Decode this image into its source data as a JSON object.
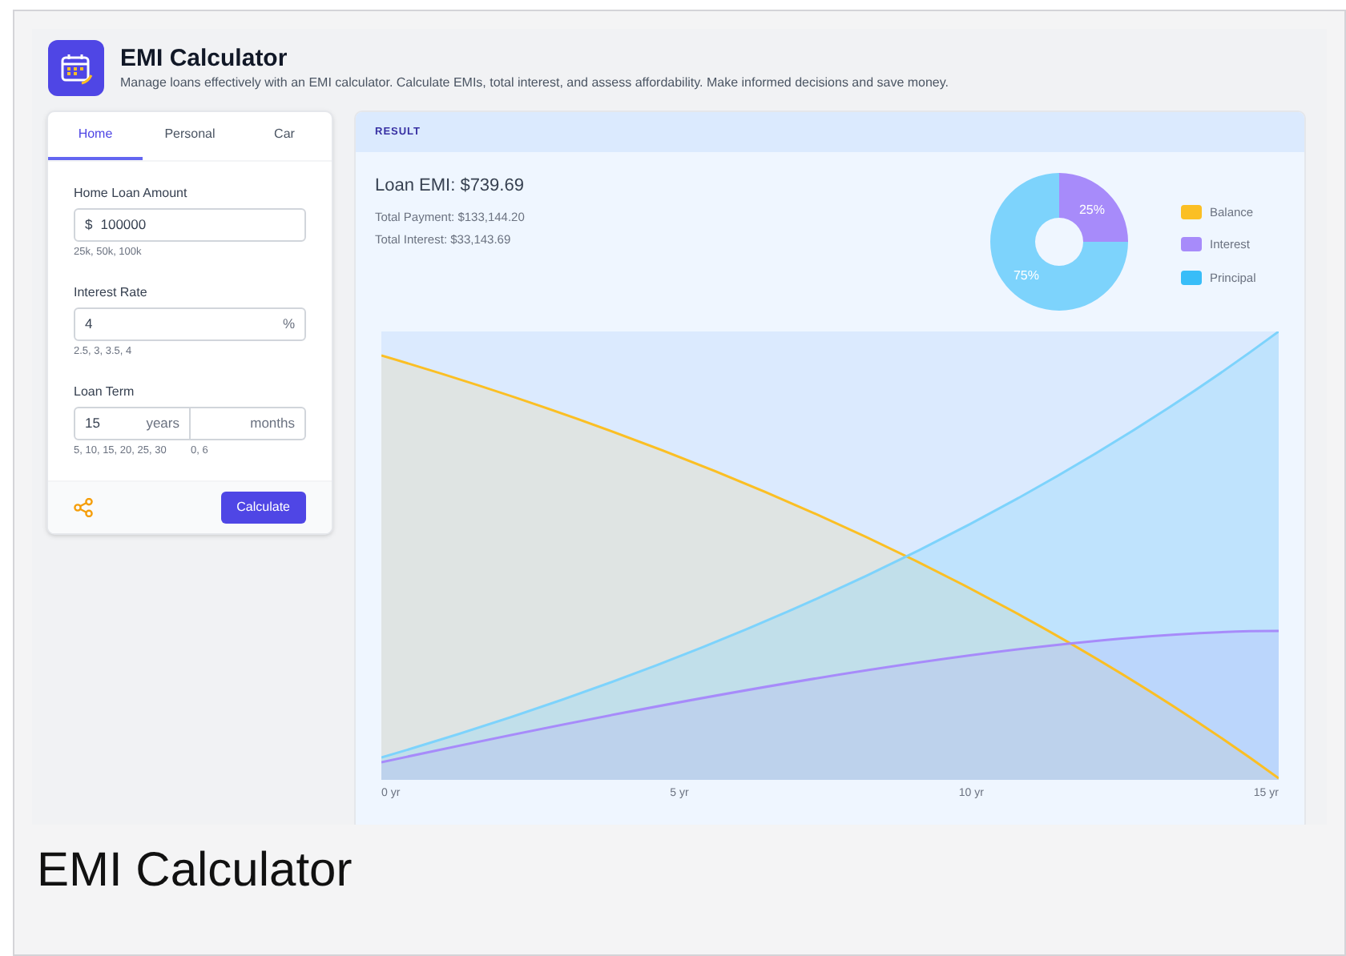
{
  "app": {
    "title": "EMI Calculator",
    "subtitle": "Manage loans effectively with an EMI calculator. Calculate EMIs, total interest, and assess affordability. Make informed decisions and save money."
  },
  "tabs": [
    {
      "label": "Home",
      "selected": true
    },
    {
      "label": "Personal",
      "selected": false
    },
    {
      "label": "Car",
      "selected": false
    }
  ],
  "form": {
    "amount": {
      "label": "Home Loan Amount",
      "prefix": "$",
      "value": "100000",
      "hint": "25k, 50k, 100k"
    },
    "rate": {
      "label": "Interest Rate",
      "value": "4",
      "suffix": "%",
      "hint": "2.5, 3, 3.5, 4"
    },
    "term": {
      "label": "Loan Term",
      "years_value": "15",
      "years_unit": "years",
      "months_unit": "months",
      "years_hint": "5, 10, 15, 20, 25, 30",
      "months_hint": "0, 6"
    },
    "button": "Calculate"
  },
  "result": {
    "header": "RESULT",
    "emi": "Loan EMI: $739.69",
    "total_payment": "Total Payment: $133,144.20",
    "total_interest": "Total Interest: $33,143.69",
    "chart_data": {
      "type": "donut",
      "values": [
        25,
        75
      ],
      "value_labels": [
        "25%",
        "75%"
      ]
    },
    "legend": [
      {
        "label": "Balance",
        "color": "#fbbf24"
      },
      {
        "label": "Interest",
        "color": "#a78bfa"
      },
      {
        "label": "Principal",
        "color": "#38bdf8"
      }
    ],
    "x_labels": [
      "0 yr",
      "5 yr",
      "10 yr",
      "15 yr"
    ]
  },
  "caption": "EMI Calculator"
}
